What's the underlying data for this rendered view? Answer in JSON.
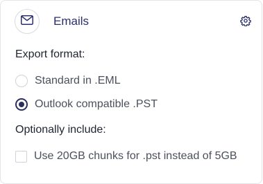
{
  "header": {
    "icon": "envelope-icon",
    "title": "Emails",
    "settings_icon": "gear-icon",
    "accent_color": "#2a2f6b"
  },
  "export_format": {
    "label": "Export format:",
    "options": [
      {
        "label": "Standard in .EML",
        "selected": false
      },
      {
        "label": "Outlook compatible .PST",
        "selected": true
      }
    ]
  },
  "optional": {
    "label": "Optionally include:",
    "options": [
      {
        "label": "Use 20GB chunks for .pst instead of 5GB",
        "checked": false
      }
    ]
  }
}
